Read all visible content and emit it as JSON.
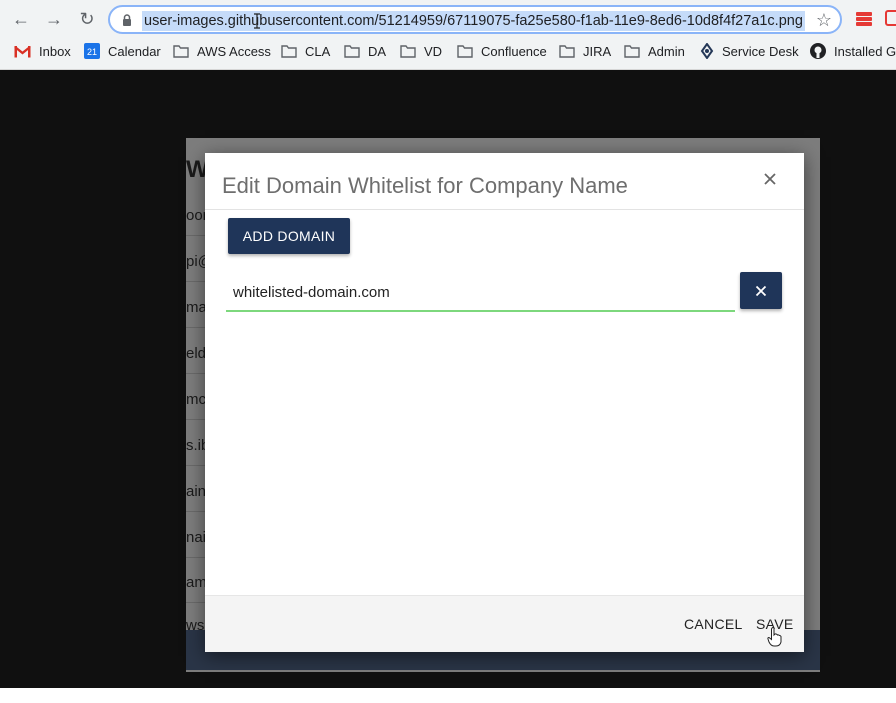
{
  "browser": {
    "url": "user-images.githubusercontent.com/51214959/67119075-fa25e580-f1ab-11e9-8ed6-10d8f4f27a1c.png",
    "bookmarks": [
      {
        "label": "Inbox",
        "icon": "gmail-icon"
      },
      {
        "label": "Calendar",
        "icon": "calendar-icon",
        "badge": "21"
      },
      {
        "label": "AWS Access",
        "icon": "folder-icon"
      },
      {
        "label": "CLA",
        "icon": "folder-icon"
      },
      {
        "label": "DA",
        "icon": "folder-icon"
      },
      {
        "label": "VD",
        "icon": "folder-icon"
      },
      {
        "label": "Confluence",
        "icon": "folder-icon"
      },
      {
        "label": "JIRA",
        "icon": "folder-icon"
      },
      {
        "label": "Admin",
        "icon": "folder-icon"
      },
      {
        "label": "Service Desk",
        "icon": "service-desk-icon"
      },
      {
        "label": "Installed G",
        "icon": "github-icon"
      }
    ]
  },
  "background": {
    "title_fragment": "Whi",
    "row_fragments": [
      "oor",
      "pi@",
      "mai",
      "eld.",
      "mcc",
      "s.ib",
      "ain",
      "nail",
      "am@",
      "wsk"
    ]
  },
  "modal": {
    "title": "Edit Domain Whitelist for Company Name",
    "add_domain_label": "ADD DOMAIN",
    "domain_value": "whitelisted-domain.com",
    "cancel_label": "CANCEL",
    "save_label": "SAVE"
  },
  "colors": {
    "primary": "#1f3559",
    "field_underline": "#7dd87d",
    "title": "#6e6e6e"
  }
}
